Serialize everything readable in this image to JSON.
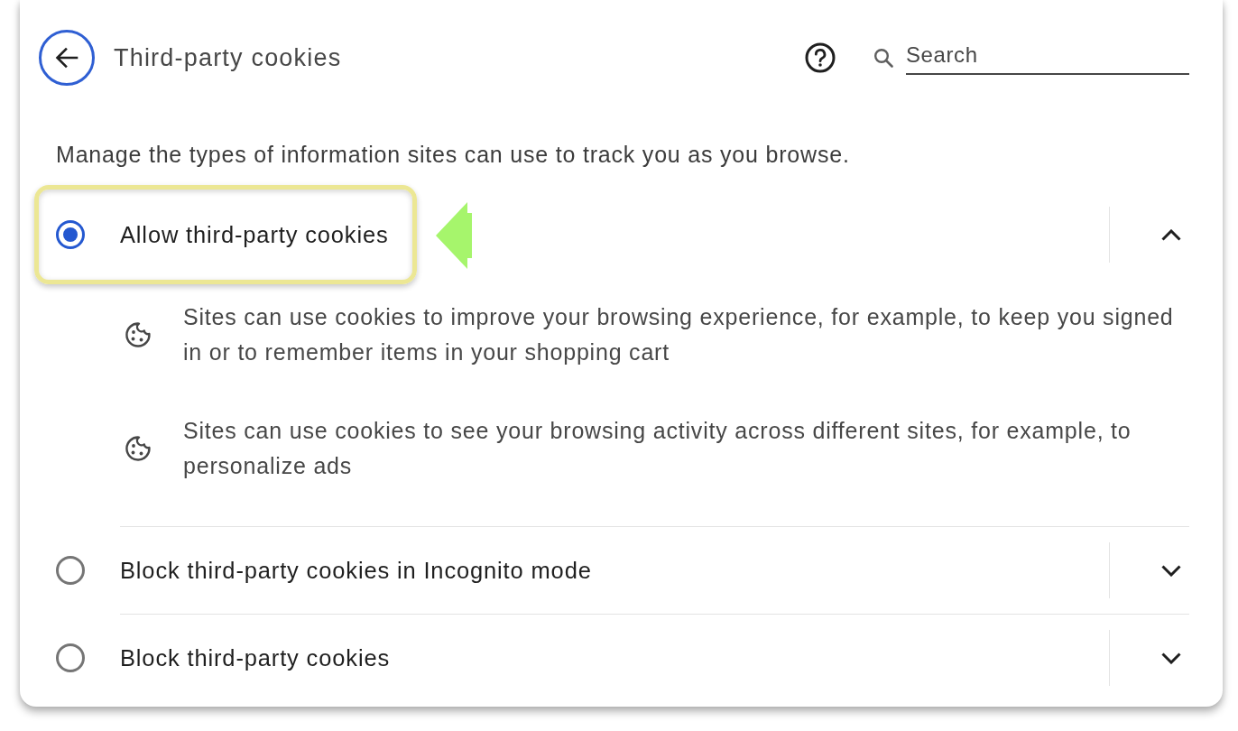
{
  "header": {
    "title": "Third-party cookies",
    "search": {
      "placeholder": "Search"
    }
  },
  "description": "Manage the types of information sites can use to track you as you browse.",
  "options": [
    {
      "label": "Allow third-party cookies",
      "selected": true,
      "expanded": true,
      "highlighted": true,
      "details": [
        {
          "text": "Sites can use cookies to improve your browsing experience, for example, to keep you signed in or to remember items in your shopping cart"
        },
        {
          "text": "Sites can use cookies to see your browsing activity across different sites, for example, to personalize ads"
        }
      ]
    },
    {
      "label": "Block third-party cookies in Incognito mode",
      "selected": false,
      "expanded": false,
      "highlighted": false
    },
    {
      "label": "Block third-party cookies",
      "selected": false,
      "expanded": false,
      "highlighted": false
    }
  ]
}
